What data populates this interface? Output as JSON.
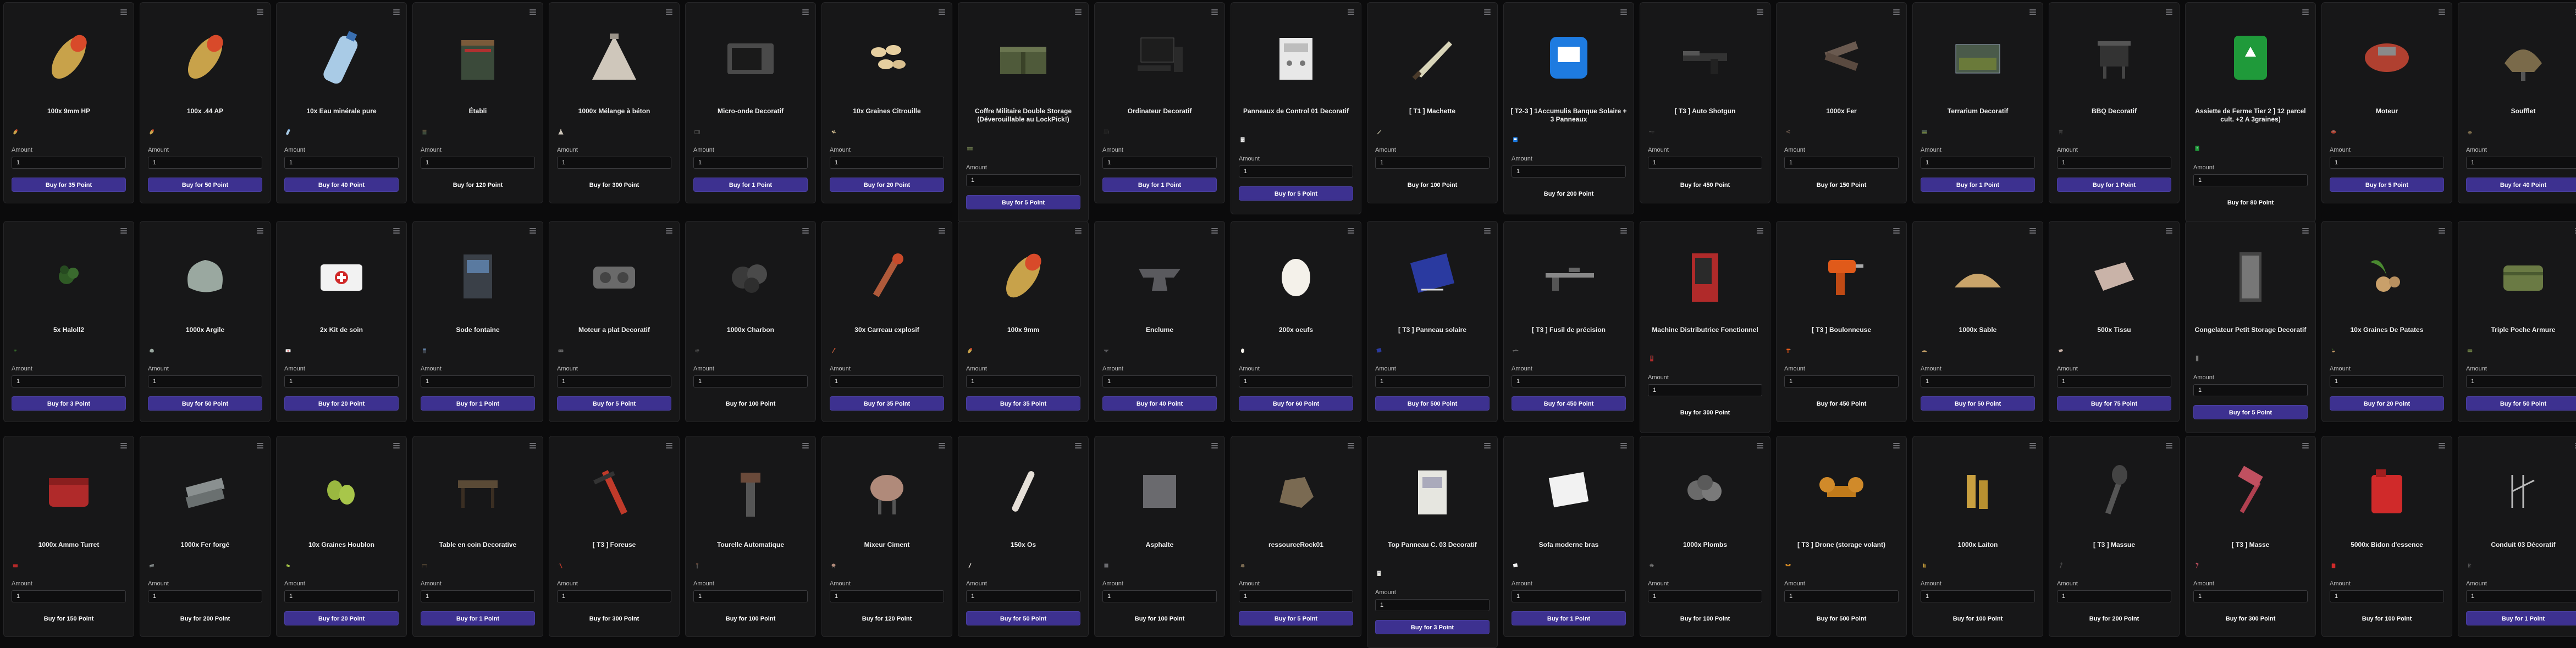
{
  "ui": {
    "amount_label": "Amount",
    "amount_value": "1",
    "accent": "#3d3190"
  },
  "rows": [
    [
      {
        "title": "100x 9mm HP",
        "price": "Buy for 35 Point",
        "icon": "bullet-icon",
        "plain": false,
        "lines": 1
      },
      {
        "title": "100x .44 AP",
        "price": "Buy for 50 Point",
        "icon": "bullet-icon",
        "plain": false,
        "lines": 1
      },
      {
        "title": "10x Eau minérale pure",
        "price": "Buy for 40 Point",
        "icon": "water-bottle-icon",
        "plain": false,
        "lines": 1
      },
      {
        "title": "Établi",
        "price": "Buy for 120 Point",
        "icon": "workbench-icon",
        "plain": true,
        "lines": 1
      },
      {
        "title": "1000x Mélange à béton",
        "price": "Buy for 300 Point",
        "icon": "cement-pile-icon",
        "plain": true,
        "lines": 1
      },
      {
        "title": "Micro-onde Decoratif",
        "price": "Buy for 1 Point",
        "icon": "microwave-icon",
        "plain": false,
        "lines": 1
      },
      {
        "title": "10x Graines Citrouille",
        "price": "Buy for 20 Point",
        "icon": "seeds-icon",
        "plain": false,
        "lines": 1
      },
      {
        "title": "Coffre Militaire Double Storage (Déverouillable au LockPick!)",
        "price": "Buy for 5 Point",
        "icon": "military-crate-icon",
        "plain": false,
        "lines": 3
      },
      {
        "title": "Ordinateur Decoratif",
        "price": "Buy for 1 Point",
        "icon": "computer-icon",
        "plain": false,
        "lines": 1
      },
      {
        "title": "Panneaux de Control 01 Decoratif",
        "price": "Buy for 5 Point",
        "icon": "control-panel-icon",
        "plain": false,
        "lines": 2
      },
      {
        "title": "[ T1 ] Machette",
        "price": "Buy for 100 Point",
        "icon": "machete-icon",
        "plain": true,
        "lines": 1
      },
      {
        "title": "[ T2-3 ] 1Accumulis Banque Solaire + 3 Panneaux",
        "price": "Buy for 200 Point",
        "icon": "solar-bank-icon",
        "plain": true,
        "lines": 2
      },
      {
        "title": "[ T3 ] Auto Shotgun",
        "price": "Buy for 450 Point",
        "icon": "shotgun-icon",
        "plain": true,
        "lines": 1
      },
      {
        "title": "1000x Fer",
        "price": "Buy for 150 Point",
        "icon": "iron-icon",
        "plain": true,
        "lines": 1
      },
      {
        "title": "Terrarium Decoratif",
        "price": "Buy for 1 Point",
        "icon": "terrarium-icon",
        "plain": false,
        "lines": 1
      },
      {
        "title": "BBQ Decoratif",
        "price": "Buy for 1 Point",
        "icon": "bbq-icon",
        "plain": false,
        "lines": 1
      },
      {
        "title": "Assiette de Ferme Tier 2 ] 12 parcel cult. +2 A 3graines)",
        "price": "Buy for 80 Point",
        "icon": "farm-plot-icon",
        "plain": true,
        "lines": 3
      },
      {
        "title": "Moteur",
        "price": "Buy for 5 Point",
        "icon": "engine-icon",
        "plain": false,
        "lines": 1
      },
      {
        "title": "Soufflet",
        "price": "Buy for 40 Point",
        "icon": "bellows-icon",
        "plain": false,
        "lines": 1
      }
    ],
    [
      {
        "title": "5x Haloll2",
        "price": "Buy for 3 Point",
        "icon": "plant-icon",
        "plain": false,
        "lines": 1
      },
      {
        "title": "1000x Argile",
        "price": "Buy for 50 Point",
        "icon": "clay-icon",
        "plain": false,
        "lines": 1
      },
      {
        "title": "2x Kit de soin",
        "price": "Buy for 20 Point",
        "icon": "medkit-icon",
        "plain": false,
        "lines": 1
      },
      {
        "title": "Sode fontaine",
        "price": "Buy for 1 Point",
        "icon": "soda-fountain-icon",
        "plain": false,
        "lines": 1
      },
      {
        "title": "Moteur a plat Decoratif",
        "price": "Buy for 5 Point",
        "icon": "flat-engine-icon",
        "plain": false,
        "lines": 1
      },
      {
        "title": "1000x Charbon",
        "price": "Buy for 100 Point",
        "icon": "coal-icon",
        "plain": true,
        "lines": 1
      },
      {
        "title": "30x Carreau explosif",
        "price": "Buy for 35 Point",
        "icon": "explosive-bolt-icon",
        "plain": false,
        "lines": 1
      },
      {
        "title": "100x 9mm",
        "price": "Buy for 35 Point",
        "icon": "bullet-icon",
        "plain": false,
        "lines": 1
      },
      {
        "title": "Enclume",
        "price": "Buy for 40 Point",
        "icon": "anvil-icon",
        "plain": false,
        "lines": 1
      },
      {
        "title": "200x oeufs",
        "price": "Buy for 60 Point",
        "icon": "egg-icon",
        "plain": false,
        "lines": 1
      },
      {
        "title": "[ T3 ] Panneau solaire",
        "price": "Buy for 500 Point",
        "icon": "solar-panel-icon",
        "plain": false,
        "lines": 1
      },
      {
        "title": "[ T3 ] Fusil de précision",
        "price": "Buy for 450 Point",
        "icon": "rifle-icon",
        "plain": false,
        "lines": 1
      },
      {
        "title": "Machine Distributrice Fonctionnel",
        "price": "Buy for 300 Point",
        "icon": "vending-machine-icon",
        "plain": true,
        "lines": 2
      },
      {
        "title": "[ T3 ] Boulonneuse",
        "price": "Buy for 450 Point",
        "icon": "drill-icon",
        "plain": true,
        "lines": 1
      },
      {
        "title": "1000x Sable",
        "price": "Buy for 50 Point",
        "icon": "sand-icon",
        "plain": false,
        "lines": 1
      },
      {
        "title": "500x Tissu",
        "price": "Buy for 75 Point",
        "icon": "cloth-icon",
        "plain": false,
        "lines": 1
      },
      {
        "title": "Congelateur Petit Storage Decoratif",
        "price": "Buy for 5 Point",
        "icon": "freezer-icon",
        "plain": false,
        "lines": 2
      },
      {
        "title": "10x Graines De Patates",
        "price": "Buy for 20 Point",
        "icon": "potato-icon",
        "plain": false,
        "lines": 1
      },
      {
        "title": "Triple Poche Armure",
        "price": "Buy for 50 Point",
        "icon": "armor-pouch-icon",
        "plain": false,
        "lines": 1
      }
    ],
    [
      {
        "title": "1000x Ammo Turret",
        "price": "Buy for 150 Point",
        "icon": "ammo-box-icon",
        "plain": true,
        "lines": 1
      },
      {
        "title": "1000x Fer forgé",
        "price": "Buy for 200 Point",
        "icon": "forged-iron-icon",
        "plain": true,
        "lines": 1
      },
      {
        "title": "10x Graines Houblon",
        "price": "Buy for 20 Point",
        "icon": "hops-icon",
        "plain": false,
        "lines": 1
      },
      {
        "title": "Table en coin Decorative",
        "price": "Buy for 1 Point",
        "icon": "corner-table-icon",
        "plain": false,
        "lines": 1
      },
      {
        "title": "[ T3 ] Foreuse",
        "price": "Buy for 300 Point",
        "icon": "auger-icon",
        "plain": true,
        "lines": 1
      },
      {
        "title": "Tourelle Automatique",
        "price": "Buy for 100 Point",
        "icon": "turret-icon",
        "plain": true,
        "lines": 1
      },
      {
        "title": "Mixeur Ciment",
        "price": "Buy for 120 Point",
        "icon": "cement-mixer-icon",
        "plain": true,
        "lines": 1
      },
      {
        "title": "150x Os",
        "price": "Buy for 50 Point",
        "icon": "bone-icon",
        "plain": false,
        "lines": 1
      },
      {
        "title": "Asphalte",
        "price": "Buy for 100 Point",
        "icon": "asphalt-icon",
        "plain": true,
        "lines": 1
      },
      {
        "title": "ressourceRock01",
        "price": "Buy for 5 Point",
        "icon": "rock-icon",
        "plain": false,
        "lines": 1
      },
      {
        "title": "Top Panneau C. 03 Decoratif",
        "price": "Buy for 3 Point",
        "icon": "panel-top-icon",
        "plain": false,
        "lines": 2
      },
      {
        "title": "Sofa moderne bras",
        "price": "Buy for 1 Point",
        "icon": "sofa-icon",
        "plain": false,
        "lines": 1
      },
      {
        "title": "1000x Plombs",
        "price": "Buy for 100 Point",
        "icon": "lead-icon",
        "plain": true,
        "lines": 1
      },
      {
        "title": "[ T3 ] Drone (storage volant)",
        "price": "Buy for 500 Point",
        "icon": "drone-icon",
        "plain": true,
        "lines": 1
      },
      {
        "title": "1000x Laiton",
        "price": "Buy for 100 Point",
        "icon": "brass-icon",
        "plain": true,
        "lines": 1
      },
      {
        "title": "[ T3 ] Massue",
        "price": "Buy for 200 Point",
        "icon": "club-icon",
        "plain": true,
        "lines": 1
      },
      {
        "title": "[ T3 ] Masse",
        "price": "Buy for 300 Point",
        "icon": "sledgehammer-icon",
        "plain": true,
        "lines": 1
      },
      {
        "title": "5000x Bidon d'essence",
        "price": "Buy for 100 Point",
        "icon": "gas-can-icon",
        "plain": true,
        "lines": 1
      },
      {
        "title": "Conduit 03 Décoratif",
        "price": "Buy for 1 Point",
        "icon": "conduit-icon",
        "plain": false,
        "lines": 1
      }
    ]
  ]
}
